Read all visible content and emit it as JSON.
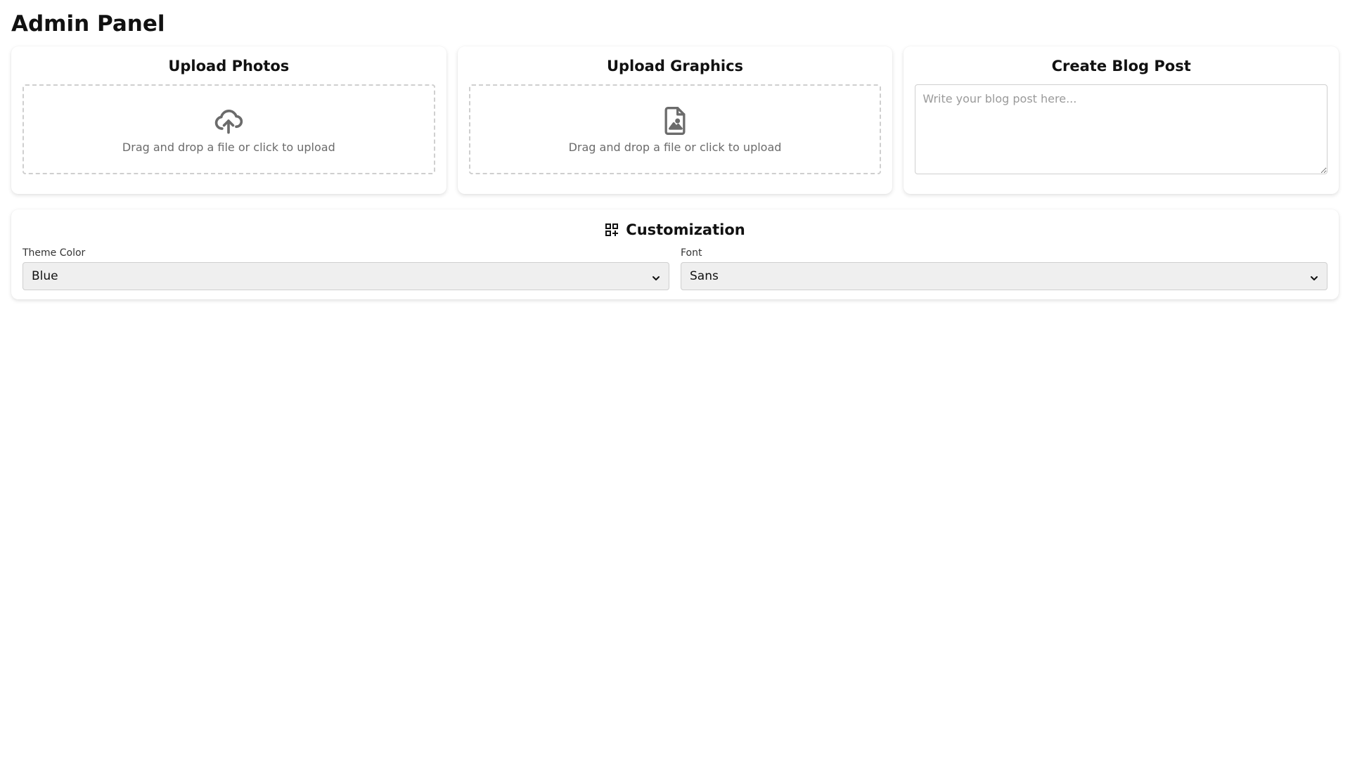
{
  "page": {
    "title": "Admin Panel"
  },
  "cards": {
    "photos": {
      "title": "Upload Photos",
      "dropzone_text": "Drag and drop a file or click to upload",
      "icon": "cloud-upload-icon"
    },
    "graphics": {
      "title": "Upload Graphics",
      "dropzone_text": "Drag and drop a file or click to upload",
      "icon": "file-image-icon"
    },
    "blog": {
      "title": "Create Blog Post",
      "placeholder": "Write your blog post here...",
      "value": ""
    }
  },
  "customization": {
    "title": "Customization",
    "icon": "grid-add-icon",
    "theme_color": {
      "label": "Theme Color",
      "selected": "Blue"
    },
    "font": {
      "label": "Font",
      "selected": "Sans"
    }
  },
  "colors": {
    "icon_gray": "#6b6b6b",
    "dashed_border": "#cfcfcf",
    "select_bg": "#efefef"
  }
}
